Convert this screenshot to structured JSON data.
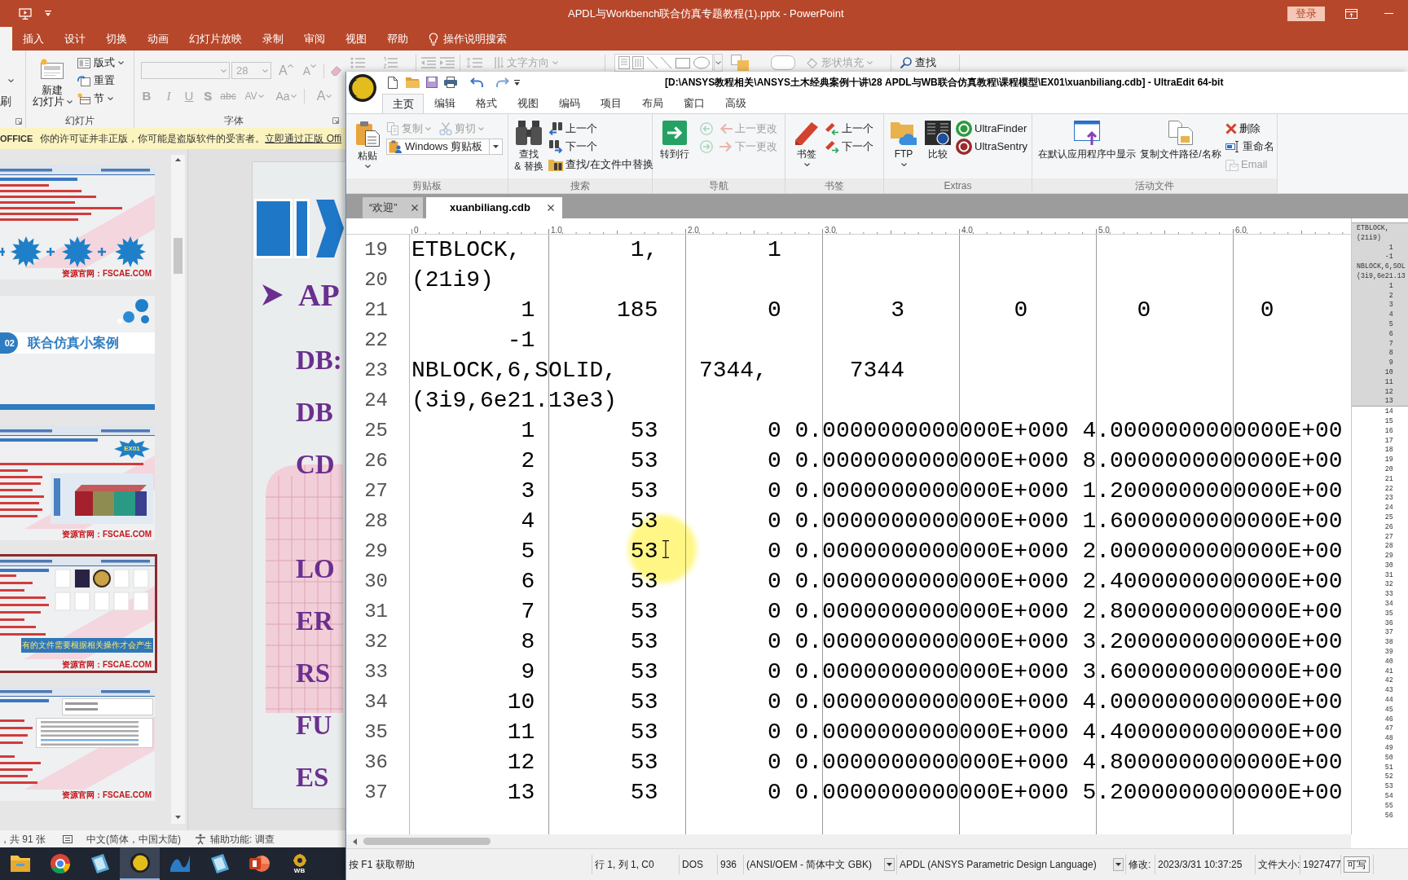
{
  "powerpoint": {
    "title": "APDL与Workbench联合仿真专题教程(1).pptx - PowerPoint",
    "sign_in": "登录",
    "tabs": [
      "插入",
      "设计",
      "切换",
      "动画",
      "幻灯片放映",
      "录制",
      "审阅",
      "视图",
      "帮助"
    ],
    "tell_me": "操作说明搜索",
    "ribbon": {
      "clipboard_fragment": "刷",
      "new_slide": {
        "lines": [
          "新建",
          "幻灯片"
        ],
        "menu": true
      },
      "slide_items": [
        {
          "label": "版式",
          "menu": true
        },
        {
          "label": "重置",
          "menu": false
        },
        {
          "label": "节",
          "menu": true
        }
      ],
      "slides_label": "幻灯片",
      "font": {
        "disabled": true,
        "size": "28",
        "size_buttons": [
          {
            "kind": "grow",
            "label": "A"
          },
          {
            "kind": "shrink",
            "label": "A"
          }
        ],
        "format_buttons": [
          {
            "kind": "bold",
            "label": "B",
            "menu": false
          },
          {
            "kind": "italic",
            "label": "I",
            "menu": false
          },
          {
            "kind": "underline",
            "label": "U",
            "menu": false
          },
          {
            "kind": "shadow",
            "label": "S",
            "menu": false
          },
          {
            "kind": "strike",
            "label": "abc",
            "menu": false
          },
          {
            "kind": "spacing",
            "label": "AV",
            "menu": true
          },
          {
            "kind": "case",
            "label": "Aa",
            "menu": true
          },
          {
            "kind": "color",
            "label": "A",
            "menu": true
          }
        ],
        "label": "字体"
      },
      "top_row": [
        {
          "kind": "text_direction",
          "label": "文字方向",
          "disabled": true,
          "menu": true
        },
        {
          "kind": "shape_fill",
          "label": "形状填充",
          "disabled": true,
          "menu": true
        },
        {
          "kind": "find",
          "label": "查找",
          "disabled": false,
          "menu": false
        }
      ]
    },
    "notice": {
      "brand": "OFFICE",
      "message": "你的许可证并非正版，你可能是盗版软件的受害者。",
      "link": "立即通过正版 Offi"
    },
    "thumbnails": [
      {
        "kind": "bullets",
        "selected": false,
        "footer": "资源官网：FSCAE.COM"
      },
      {
        "kind": "section",
        "selected": false,
        "number": "02",
        "title": "联合仿真小案例"
      },
      {
        "kind": "case",
        "selected": false,
        "badge": "EX01",
        "footer": "资源官网：FSCAE.COM"
      },
      {
        "kind": "files",
        "selected": true,
        "callout": "有的文件需要根据相关操作才会产生",
        "footer": "资源官网：FSCAE.COM"
      },
      {
        "kind": "explorer",
        "selected": false,
        "footer": "资源官网：FSCAE.COM"
      }
    ],
    "slide": {
      "heading": "AP",
      "items": [
        "DB:",
        "DB",
        "CD",
        "LO",
        "ER",
        "RS",
        "FU",
        "ES"
      ]
    },
    "status": {
      "slides": "，共 91 张",
      "language": "中文(简体，中国大陆)",
      "accessibility": "辅助功能: 调查"
    }
  },
  "taskbar": [
    {
      "kind": "explorer",
      "active": false
    },
    {
      "kind": "browser",
      "active": false
    },
    {
      "kind": "glass",
      "active": false
    },
    {
      "kind": "ultraedit",
      "active": true
    },
    {
      "kind": "wave",
      "active": false
    },
    {
      "kind": "glass",
      "active": false
    },
    {
      "kind": "powerpoint",
      "active": false
    },
    {
      "kind": "workbench",
      "active": false,
      "label": "WB"
    }
  ],
  "ultraedit": {
    "title": "[D:\\ANSYS教程相关\\ANSYS土木经典案例十讲\\28 APDL与WB联合仿真教程\\课程模型\\EX01\\xuanbiliang.cdb] - UltraEdit 64-bit",
    "tabs": [
      {
        "label": "主页",
        "selected": true
      },
      {
        "label": "编辑",
        "selected": false
      },
      {
        "label": "格式",
        "selected": false
      },
      {
        "label": "视图",
        "selected": false
      },
      {
        "label": "编码",
        "selected": false
      },
      {
        "label": "项目",
        "selected": false
      },
      {
        "label": "布局",
        "selected": false
      },
      {
        "label": "窗口",
        "selected": false
      },
      {
        "label": "高级",
        "selected": false
      }
    ],
    "groups": [
      {
        "label": "剪贴板",
        "columns": [
          {
            "kind": "large",
            "label": "粘贴",
            "menu": true,
            "disabled": false
          },
          {
            "kind": "stack",
            "rows": [
              [
                {
                  "kind": "button",
                  "label": "复制",
                  "menu": true,
                  "disabled": true
                },
                {
                  "kind": "button",
                  "label": "剪切",
                  "menu": true,
                  "disabled": true
                }
              ],
              [
                {
                  "kind": "combo",
                  "label": "Windows 剪贴板"
                }
              ]
            ]
          }
        ]
      },
      {
        "label": "搜索",
        "columns": [
          {
            "kind": "large",
            "label": "查找\n& 替换",
            "menu": false,
            "disabled": false
          },
          {
            "kind": "stack",
            "rows": [
              [
                {
                  "kind": "button",
                  "label": "上一个",
                  "menu": false,
                  "disabled": false
                }
              ],
              [
                {
                  "kind": "button",
                  "label": "下一个",
                  "menu": false,
                  "disabled": false
                }
              ],
              [
                {
                  "kind": "button",
                  "label": "查找/在文件中替换",
                  "menu": false,
                  "disabled": false
                }
              ]
            ]
          }
        ]
      },
      {
        "label": "导航",
        "columns": [
          {
            "kind": "large",
            "label": "转到行",
            "menu": false,
            "disabled": false
          },
          {
            "kind": "stack",
            "rows": [
              [
                {
                  "kind": "icon",
                  "disabled": true
                }
              ],
              [
                {
                  "kind": "icon",
                  "disabled": true
                }
              ]
            ]
          },
          {
            "kind": "stack",
            "rows": [
              [
                {
                  "kind": "button",
                  "label": "上一更改",
                  "menu": false,
                  "disabled": true
                }
              ],
              [
                {
                  "kind": "button",
                  "label": "下一更改",
                  "menu": false,
                  "disabled": true
                }
              ]
            ]
          }
        ]
      },
      {
        "label": "书签",
        "columns": [
          {
            "kind": "large",
            "label": "书签",
            "menu": true,
            "disabled": false
          },
          {
            "kind": "stack",
            "rows": [
              [
                {
                  "kind": "button",
                  "label": "上一个",
                  "menu": false,
                  "disabled": false
                }
              ],
              [
                {
                  "kind": "button",
                  "label": "下一个",
                  "menu": false,
                  "disabled": false
                }
              ]
            ]
          }
        ]
      },
      {
        "label": "Extras",
        "columns": [
          {
            "kind": "large",
            "label": "FTP",
            "menu": true,
            "disabled": false
          },
          {
            "kind": "large",
            "label": "比较",
            "menu": false,
            "disabled": false
          },
          {
            "kind": "stack",
            "rows": [
              [
                {
                  "kind": "button",
                  "label": "UltraFinder",
                  "menu": false,
                  "disabled": false
                }
              ],
              [
                {
                  "kind": "button",
                  "label": "UltraSentry",
                  "menu": false,
                  "disabled": false
                }
              ]
            ]
          }
        ]
      },
      {
        "label": "活动文件",
        "columns": [
          {
            "kind": "large",
            "label": "在默认应用程序中显示",
            "menu": false,
            "disabled": false
          },
          {
            "kind": "large",
            "label": "复制文件路径/名称",
            "menu": false,
            "disabled": false
          },
          {
            "kind": "stack",
            "rows": [
              [
                {
                  "kind": "button",
                  "label": "删除",
                  "menu": false,
                  "disabled": false
                }
              ],
              [
                {
                  "kind": "button",
                  "label": "重命名",
                  "menu": false,
                  "disabled": false
                }
              ],
              [
                {
                  "kind": "button",
                  "label": "Email",
                  "menu": false,
                  "disabled": true
                }
              ]
            ]
          }
        ]
      }
    ],
    "documents": [
      {
        "label": "“欢迎”",
        "selected": false
      },
      {
        "label": "xuanbiliang.cdb",
        "selected": true
      }
    ],
    "ruler": [
      "0",
      "1.0",
      "2.0",
      "3.0",
      "4.0",
      "5.0",
      "6.0"
    ],
    "lines": [
      {
        "number": "19",
        "text": "ETBLOCK,        1,        1"
      },
      {
        "number": "20",
        "text": "(21i9)"
      },
      {
        "number": "21",
        "text": "        1      185        0        3        0        0        0"
      },
      {
        "number": "22",
        "text": "       -1"
      },
      {
        "number": "23",
        "text": "NBLOCK,6,SOLID,      7344,      7344"
      },
      {
        "number": "24",
        "text": "(3i9,6e21.13e3)"
      },
      {
        "number": "25",
        "text": "        1       53        0 0.0000000000000E+000 4.0000000000000E+00"
      },
      {
        "number": "26",
        "text": "        2       53        0 0.0000000000000E+000 8.0000000000000E+00"
      },
      {
        "number": "27",
        "text": "        3       53        0 0.0000000000000E+000 1.2000000000000E+00"
      },
      {
        "number": "28",
        "text": "        4       53        0 0.0000000000000E+000 1.6000000000000E+00"
      },
      {
        "number": "29",
        "text": "        5       53        0 0.0000000000000E+000 2.0000000000000E+00"
      },
      {
        "number": "30",
        "text": "        6       53        0 0.0000000000000E+000 2.4000000000000E+00"
      },
      {
        "number": "31",
        "text": "        7       53        0 0.0000000000000E+000 2.8000000000000E+00"
      },
      {
        "number": "32",
        "text": "        8       53        0 0.0000000000000E+000 3.2000000000000E+00"
      },
      {
        "number": "33",
        "text": "        9       53        0 0.0000000000000E+000 3.6000000000000E+00"
      },
      {
        "number": "34",
        "text": "       10       53        0 0.0000000000000E+000 4.0000000000000E+00"
      },
      {
        "number": "35",
        "text": "       11       53        0 0.0000000000000E+000 4.4000000000000E+00"
      },
      {
        "number": "36",
        "text": "       12       53        0 0.0000000000000E+000 4.8000000000000E+00"
      },
      {
        "number": "37",
        "text": "       13       53        0 0.0000000000000E+000 5.2000000000000E+00"
      }
    ],
    "minimap": {
      "in_view": [
        "ETBLOCK,",
        "(21i9)",
        "        1",
        "       -1",
        "NBLOCK,6,SOL",
        "(3i9,6e21.13",
        "        1",
        "        2",
        "        3",
        "        4",
        "        5",
        "        6",
        "        7",
        "        8",
        "        9",
        "       10",
        "       11",
        "       12",
        "       13"
      ],
      "below": [
        "       14",
        "       15",
        "       16",
        "       17",
        "       18",
        "       19",
        "       20",
        "       21",
        "       22",
        "       23",
        "       24",
        "       25",
        "       26",
        "       27",
        "       28",
        "       29",
        "       30",
        "       31",
        "       32",
        "       33",
        "       34",
        "       35",
        "       36",
        "       37",
        "       38",
        "       39",
        "       40",
        "       41",
        "       42",
        "       43",
        "       44",
        "       45",
        "       46",
        "       47",
        "       48",
        "       49",
        "       50",
        "       51",
        "       52",
        "       53",
        "       54",
        "       55",
        "       56"
      ]
    },
    "status": [
      {
        "kind": "text",
        "text": "按 F1 获取帮助"
      },
      {
        "kind": "text",
        "text": "行 1, 列 1, C0"
      },
      {
        "kind": "text",
        "text": "DOS"
      },
      {
        "kind": "text",
        "text": "936"
      },
      {
        "kind": "dropdown",
        "text": "(ANSI/OEM - 简体中文 GBK)"
      },
      {
        "kind": "dropdown",
        "text": "APDL (ANSYS Parametric Design Language)"
      },
      {
        "kind": "text",
        "text": "修改:"
      },
      {
        "kind": "text",
        "text": "2023/3/31 10:37:25"
      },
      {
        "kind": "text",
        "text": "文件大小:"
      },
      {
        "kind": "text",
        "text": "1927477"
      },
      {
        "kind": "button",
        "text": "可写"
      }
    ]
  }
}
